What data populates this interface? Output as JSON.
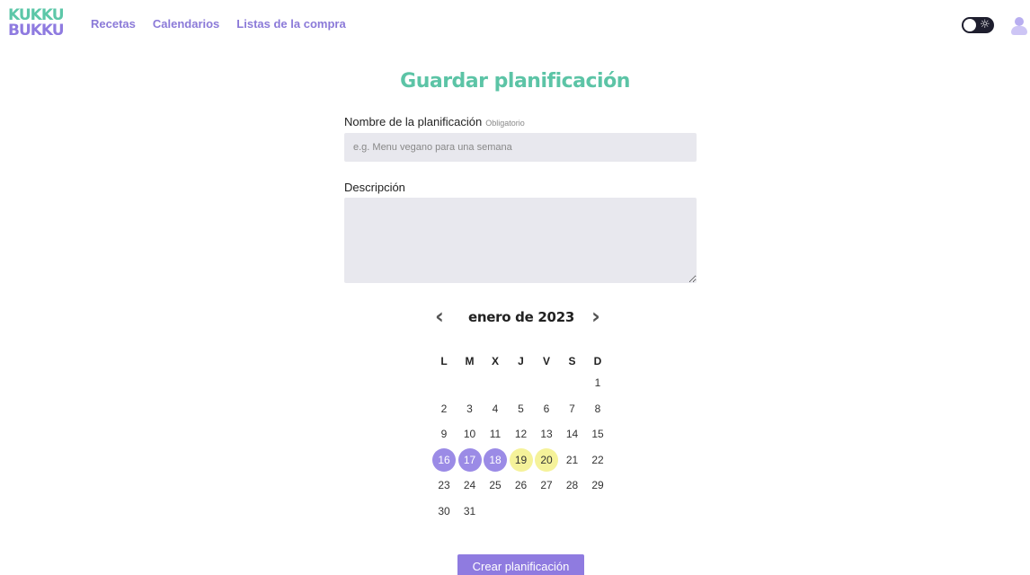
{
  "header": {
    "logo_line1": "KUKKU",
    "logo_line2": "BUKKU",
    "nav": [
      "Recetas",
      "Calendarios",
      "Listas de la compra"
    ],
    "theme_toggle_icon": "sun-icon",
    "avatar_icon": "user-icon"
  },
  "title": "Guardar planificación",
  "form": {
    "name_label": "Nombre de la planificación",
    "name_required": "Obligatorio",
    "name_placeholder": "e.g. Menu vegano para una semana",
    "description_label": "Descripción"
  },
  "calendar": {
    "prev_icon": "chevron-left-icon",
    "next_icon": "chevron-right-icon",
    "month": "enero de 2023",
    "weekdays": [
      "L",
      "M",
      "X",
      "J",
      "V",
      "S",
      "D"
    ],
    "weeks": [
      [
        "",
        "",
        "",
        "",
        "",
        "",
        "1"
      ],
      [
        "2",
        "3",
        "4",
        "5",
        "6",
        "7",
        "8"
      ],
      [
        "9",
        "10",
        "11",
        "12",
        "13",
        "14",
        "15"
      ],
      [
        "16",
        "17",
        "18",
        "19",
        "20",
        "21",
        "22"
      ],
      [
        "23",
        "24",
        "25",
        "26",
        "27",
        "28",
        "29"
      ],
      [
        "30",
        "31",
        "",
        "",
        "",
        "",
        ""
      ]
    ],
    "highlight_purple": [
      "16",
      "17",
      "18"
    ],
    "highlight_yellow": [
      "19",
      "20"
    ],
    "colors": {
      "purple": "#9b8be6",
      "yellow": "#f5f29a"
    }
  },
  "submit_label": "Crear planificación"
}
